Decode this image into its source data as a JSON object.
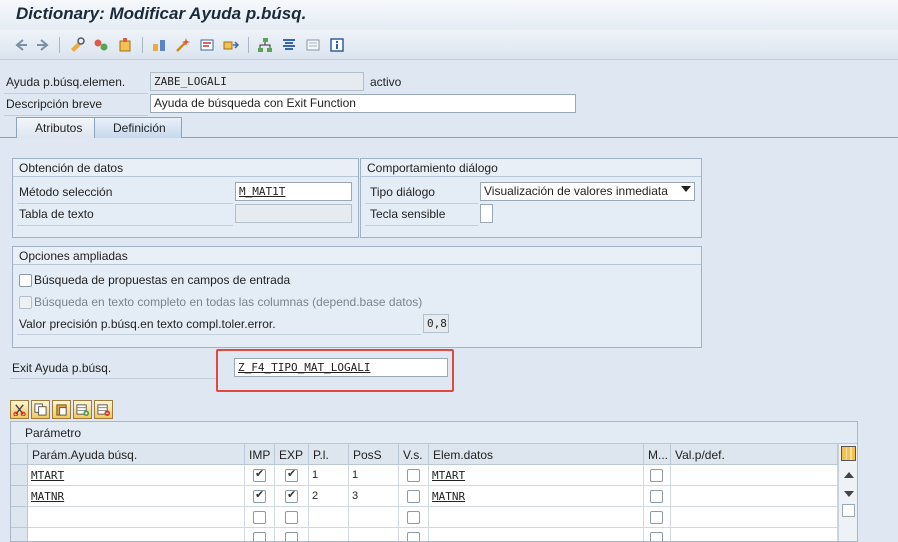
{
  "window": {
    "title": "Dictionary: Modificar Ayuda p.búsq."
  },
  "header": {
    "name_label": "Ayuda p.búsq.elemen.",
    "name_value": "ZABE_LOGALI",
    "status": "activo",
    "desc_label": "Descripción breve",
    "desc_value": "Ayuda de búsqueda con Exit Function"
  },
  "tabs": [
    {
      "label": "Atributos",
      "active": false
    },
    {
      "label": "Definición",
      "active": true
    }
  ],
  "obtencion": {
    "title": "Obtención de datos",
    "method_label": "Método selección",
    "method_value": "M_MAT1T",
    "text_table_label": "Tabla de texto",
    "text_table_value": ""
  },
  "comportamiento": {
    "title": "Comportamiento diálogo",
    "type_label": "Tipo diálogo",
    "type_value": "Visualización de valores inmediata",
    "hotkey_label": "Tecla sensible",
    "hotkey_value": ""
  },
  "opciones": {
    "title": "Opciones ampliadas",
    "check1_label": "Búsqueda de propuestas en campos de entrada",
    "check2_label": "Búsqueda en texto completo en todas las columnas (depend.base datos)",
    "precision_label": "Valor precisión p.búsq.en texto compl.toler.error.",
    "precision_value": "0,8"
  },
  "exit": {
    "label": "Exit Ayuda p.búsq.",
    "value": "Z_F4_TIPO_MAT_LOGALI"
  },
  "table": {
    "title": "Parámetro",
    "columns": [
      "Parám.Ayuda búsq.",
      "IMP",
      "EXP",
      "P.l.",
      "PosS",
      "V.s.",
      "Elem.datos",
      "M...",
      "Val.p/def."
    ],
    "rows": [
      {
        "param": "MTART",
        "imp": true,
        "exp": true,
        "pl": "1",
        "pos": "1",
        "vs": false,
        "elem": "MTART",
        "m": false,
        "def": ""
      },
      {
        "param": "MATNR",
        "imp": true,
        "exp": true,
        "pl": "2",
        "pos": "3",
        "vs": false,
        "elem": "MATNR",
        "m": false,
        "def": ""
      },
      {
        "param": "",
        "imp": false,
        "exp": false,
        "pl": "",
        "pos": "",
        "vs": false,
        "elem": "",
        "m": false,
        "def": ""
      },
      {
        "param": "",
        "imp": false,
        "exp": false,
        "pl": "",
        "pos": "",
        "vs": false,
        "elem": "",
        "m": false,
        "def": ""
      }
    ]
  },
  "colors": {
    "highlight_border": "#e04a3f",
    "background": "#dfe8f2"
  }
}
